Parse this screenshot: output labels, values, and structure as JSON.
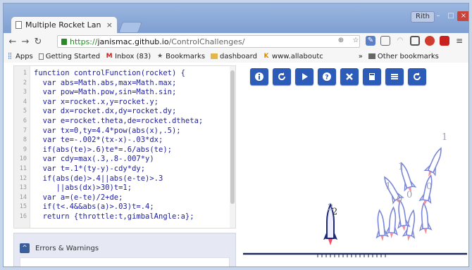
{
  "browser": {
    "tab_title": "Multiple Rocket Lan",
    "tab_close": "×",
    "user_badge": "Rith",
    "window_controls": [
      "–",
      "□",
      "×"
    ],
    "url": {
      "scheme": "https://",
      "host": "janismac.github.io",
      "path": "/ControlChallenges/"
    }
  },
  "bookmarks_bar": {
    "items": [
      {
        "icon": "apps-grid-icon",
        "label": "Apps"
      },
      {
        "icon": "page-icon",
        "label": "Getting Started"
      },
      {
        "icon": "gmail-icon",
        "label": "Inbox (83)"
      },
      {
        "icon": "star-icon",
        "label": "Bookmarks"
      },
      {
        "icon": "folder-icon",
        "label": "dashboard"
      },
      {
        "icon": "k-icon",
        "label": "www.allaboutc"
      }
    ],
    "overflow": "»",
    "other": "Other bookmarks"
  },
  "editor": {
    "lines": [
      {
        "n": "1",
        "code": "function controlFunction(rocket) {"
      },
      {
        "n": "2",
        "code": "  var abs=Math.abs,max=Math.max;"
      },
      {
        "n": "3",
        "code": "  var pow=Math.pow,sin=Math.sin;"
      },
      {
        "n": "4",
        "code": "  var x=rocket.x,y=rocket.y;"
      },
      {
        "n": "5",
        "code": "  var dx=rocket.dx,dy=rocket.dy;"
      },
      {
        "n": "6",
        "code": "  var e=rocket.theta,de=rocket.dtheta;"
      },
      {
        "n": "7",
        "code": "  var tx=0,ty=4.4*pow(abs(x),.5);"
      },
      {
        "n": "8",
        "code": "  var te=-.002*(tx-x)-.03*dx;"
      },
      {
        "n": "9",
        "code": "  if(abs(te)>.6)te*=.6/abs(te);"
      },
      {
        "n": "10",
        "code": "  var cdy=max(.3,.8-.007*y)"
      },
      {
        "n": "11",
        "code": "  var t=.1*(ty-y)-cdy*dy;"
      },
      {
        "n": "12",
        "code": "  if(abs(de)>.4||abs(e-te)>.3"
      },
      {
        "n": "13",
        "code": "     ||abs(dx)>30)t=1;"
      },
      {
        "n": "14",
        "code": "  var a=(e-te)/2+de;"
      },
      {
        "n": "15",
        "code": "  if(t<.4&&abs(a)>.03)t=.4;"
      },
      {
        "n": "16",
        "code": "  return {throttle:t,gimbalAngle:a};"
      }
    ]
  },
  "errors_panel": {
    "title": "Errors & Warnings",
    "toggle": "^"
  },
  "simulation": {
    "labels": [
      "1",
      "1",
      "1",
      "0",
      "0",
      "0",
      "2",
      "2"
    ]
  }
}
